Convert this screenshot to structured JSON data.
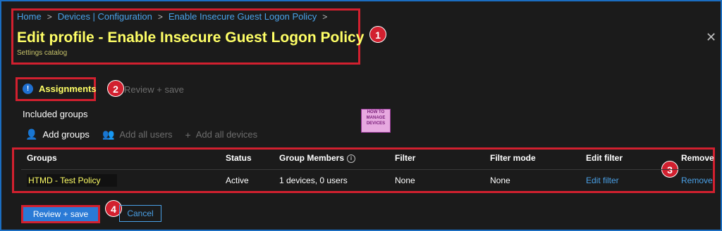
{
  "breadcrumb": [
    "Home",
    "Devices | Configuration",
    "Enable Insecure Guest Logon Policy"
  ],
  "header": {
    "title": "Edit profile - Enable Insecure Guest Logon Policy",
    "subtitle": "Settings catalog"
  },
  "tabs": [
    {
      "label": "Assignments",
      "icon": "info-icon"
    },
    {
      "label": "Review + save"
    }
  ],
  "section": {
    "label": "Included groups"
  },
  "logo": {
    "lines": [
      "HOW TO",
      "MANAGE",
      "DEVICES"
    ]
  },
  "toolbar": {
    "add_groups": "Add groups",
    "add_all_users": "Add all users",
    "add_all_devices": "Add all devices"
  },
  "table": {
    "headers": [
      "Groups",
      "Status",
      "Group Members",
      "Filter",
      "Filter mode",
      "Edit filter",
      "Remove"
    ],
    "rows": [
      [
        "HTMD - Test Policy",
        "Active",
        "1 devices, 0 users",
        "None",
        "None",
        "Edit filter",
        "Remove"
      ]
    ]
  },
  "footer": {
    "review_save": "Review + save",
    "cancel": "Cancel"
  },
  "badges": [
    "1",
    "2",
    "3",
    "4"
  ],
  "colors": {
    "highlight": "#ffff66",
    "callout": "#d2202f",
    "link": "#4aa0e6",
    "primary": "#2a7ad6"
  }
}
